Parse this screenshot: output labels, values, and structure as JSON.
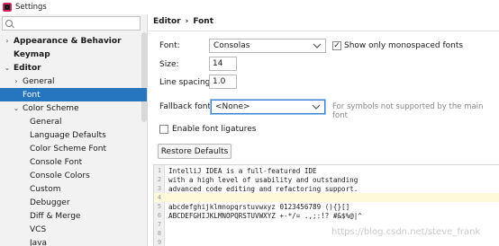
{
  "window": {
    "title": "Settings"
  },
  "search": {
    "value": "",
    "placeholder": ""
  },
  "sidebar": {
    "items": [
      {
        "label": "Appearance & Behavior",
        "arrow": "›"
      },
      {
        "label": "Keymap",
        "arrow": ""
      },
      {
        "label": "Editor",
        "arrow": "⌄"
      },
      {
        "label": "General",
        "arrow": "›"
      },
      {
        "label": "Font",
        "arrow": ""
      },
      {
        "label": "Color Scheme",
        "arrow": "⌄"
      },
      {
        "label": "General",
        "arrow": ""
      },
      {
        "label": "Language Defaults",
        "arrow": ""
      },
      {
        "label": "Color Scheme Font",
        "arrow": ""
      },
      {
        "label": "Console Font",
        "arrow": ""
      },
      {
        "label": "Console Colors",
        "arrow": ""
      },
      {
        "label": "Custom",
        "arrow": ""
      },
      {
        "label": "Debugger",
        "arrow": ""
      },
      {
        "label": "Diff & Merge",
        "arrow": ""
      },
      {
        "label": "VCS",
        "arrow": ""
      },
      {
        "label": "Java",
        "arrow": ""
      }
    ]
  },
  "breadcrumb": {
    "parent": "Editor",
    "separator": "›",
    "current": "Font"
  },
  "form": {
    "font_label": "Font:",
    "font_value": "Consolas",
    "monospaced_label": "Show only monospaced fonts",
    "monospaced_checked": true,
    "size_label": "Size:",
    "size_value": "14",
    "line_spacing_label": "Line spacing:",
    "line_spacing_value": "1.0",
    "fallback_label": "Fallback font:",
    "fallback_value": "<None>",
    "fallback_hint": "For symbols not supported by the main font",
    "ligatures_label": "Enable font ligatures",
    "ligatures_checked": false,
    "restore_label": "Restore Defaults"
  },
  "preview": {
    "lines": [
      {
        "num": "1",
        "text": "IntelliJ IDEA is a full-featured IDE"
      },
      {
        "num": "2",
        "text": "with a high level of usability and outstanding"
      },
      {
        "num": "3",
        "text": "advanced code editing and refactoring support."
      },
      {
        "num": "4",
        "text": ""
      },
      {
        "num": "5",
        "text": "abcdefghijklmnopqrstuvwxyz 0123456789 (){}[]"
      },
      {
        "num": "6",
        "text": "ABCDEFGHIJKLMNOPQRSTUVWXYZ +-*/= .,;:!? #&$%@|^"
      },
      {
        "num": "7",
        "text": ""
      },
      {
        "num": "8",
        "text": ""
      },
      {
        "num": "9",
        "text": ""
      }
    ]
  },
  "watermark": "https://blog.csdn.net/steve_frank",
  "colors": {
    "selection": "#2675bf",
    "current_line": "#fcfad9",
    "focus": "#3b84d1"
  }
}
